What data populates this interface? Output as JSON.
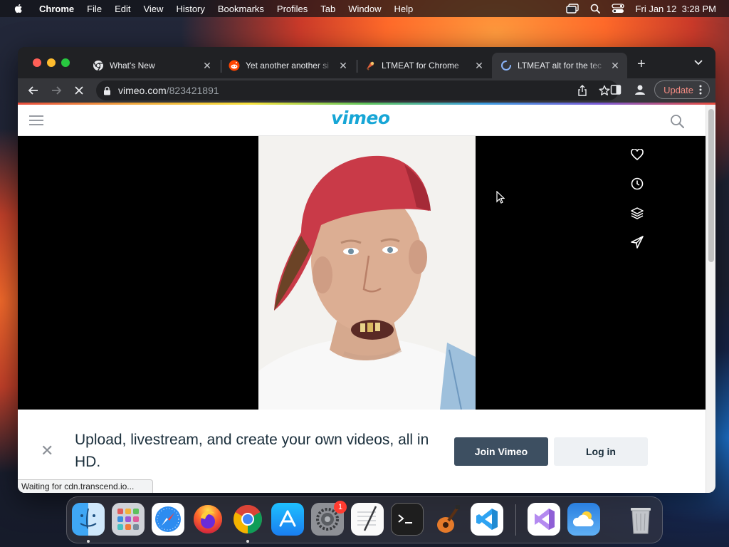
{
  "menubar": {
    "app_name": "Chrome",
    "items": [
      "File",
      "Edit",
      "View",
      "History",
      "Bookmarks",
      "Profiles",
      "Tab",
      "Window",
      "Help"
    ],
    "clock": "Fri Jan 12  3:28 PM"
  },
  "tabs": [
    {
      "title": "What's New",
      "favicon": "chrome-icon",
      "active": false
    },
    {
      "title": "Yet another another si",
      "favicon": "reddit-icon",
      "active": false
    },
    {
      "title": "LTMEAT for Chrome",
      "favicon": "extension-icon",
      "active": false
    },
    {
      "title": "LTMEAT alt for the tec",
      "favicon": "loading-spinner-icon",
      "active": true
    }
  ],
  "toolbar": {
    "url_domain": "vimeo.com",
    "url_path": "/823421891",
    "update_label": "Update"
  },
  "vimeo": {
    "logo_text": "vimeo"
  },
  "banner": {
    "headline": "Upload, livestream, and create your own videos, all in HD.",
    "join_label": "Join Vimeo",
    "login_label": "Log in"
  },
  "status_text": "Waiting for cdn.transcend.io...",
  "dock": {
    "apps": [
      "Finder",
      "Launchpad",
      "Safari",
      "Firefox",
      "Google Chrome",
      "App Store",
      "System Settings",
      "TextEdit",
      "Terminal",
      "GarageBand",
      "Visual Studio Code",
      "Visual Studio",
      "Weather",
      "Trash"
    ],
    "settings_badge": "1"
  },
  "colors": {
    "vimeo_blue": "#17a6d6",
    "join_button": "#3d4f61",
    "update_text": "#f28b82"
  }
}
